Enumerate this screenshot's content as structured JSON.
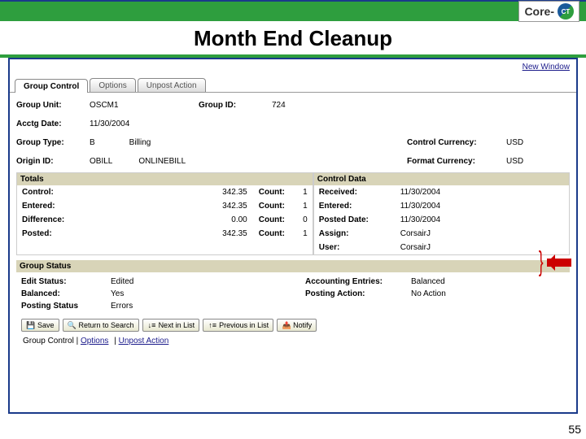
{
  "logo_text": "Core-",
  "logo_circle": "CT",
  "title": "Month End Cleanup",
  "new_window": "New Window",
  "tabs": [
    "Group Control",
    "Options",
    "Unpost Action"
  ],
  "header": {
    "group_unit_lbl": "Group Unit:",
    "group_unit": "OSCM1",
    "group_id_lbl": "Group ID:",
    "group_id": "724",
    "acctg_date_lbl": "Acctg Date:",
    "acctg_date": "11/30/2004",
    "group_type_lbl": "Group Type:",
    "group_type": "B",
    "group_type_txt": "Billing",
    "control_currency_lbl": "Control Currency:",
    "control_currency": "USD",
    "origin_id_lbl": "Origin ID:",
    "origin_id": "OBILL",
    "origin_txt": "ONLINEBILL",
    "format_currency_lbl": "Format Currency:",
    "format_currency": "USD"
  },
  "totals_bar": "Totals",
  "control_data_bar": "Control Data",
  "totals": {
    "control_lbl": "Control:",
    "control": "342.35",
    "control_cnt_lbl": "Count:",
    "control_cnt": "1",
    "entered_lbl": "Entered:",
    "entered": "342.35",
    "entered_cnt_lbl": "Count:",
    "entered_cnt": "1",
    "difference_lbl": "Difference:",
    "difference": "0.00",
    "difference_cnt_lbl": "Count:",
    "difference_cnt": "0",
    "posted_lbl": "Posted:",
    "posted": "342.35",
    "posted_cnt_lbl": "Count:",
    "posted_cnt": "1"
  },
  "control_data": {
    "received_lbl": "Received:",
    "received": "11/30/2004",
    "entered_lbl": "Entered:",
    "entered": "11/30/2004",
    "posted_date_lbl": "Posted Date:",
    "posted_date": "11/30/2004",
    "assign_lbl": "Assign:",
    "assign": "CorsairJ",
    "user_lbl": "User:",
    "user": "CorsairJ"
  },
  "group_status_bar": "Group Status",
  "status": {
    "edit_status_lbl": "Edit Status:",
    "edit_status": "Edited",
    "balanced_lbl": "Balanced:",
    "balanced": "Yes",
    "posting_status_lbl": "Posting Status",
    "posting_status": "Errors",
    "acct_entries_lbl": "Accounting Entries:",
    "acct_entries": "Balanced",
    "posting_action_lbl": "Posting Action:",
    "posting_action": "No Action"
  },
  "buttons": {
    "save": "Save",
    "return": "Return to Search",
    "next": "Next in List",
    "prev": "Previous in List",
    "notify": "Notify"
  },
  "footlinks": {
    "a": "Group Control",
    "b": "Options",
    "c": "Unpost Action"
  },
  "page_num": "55"
}
